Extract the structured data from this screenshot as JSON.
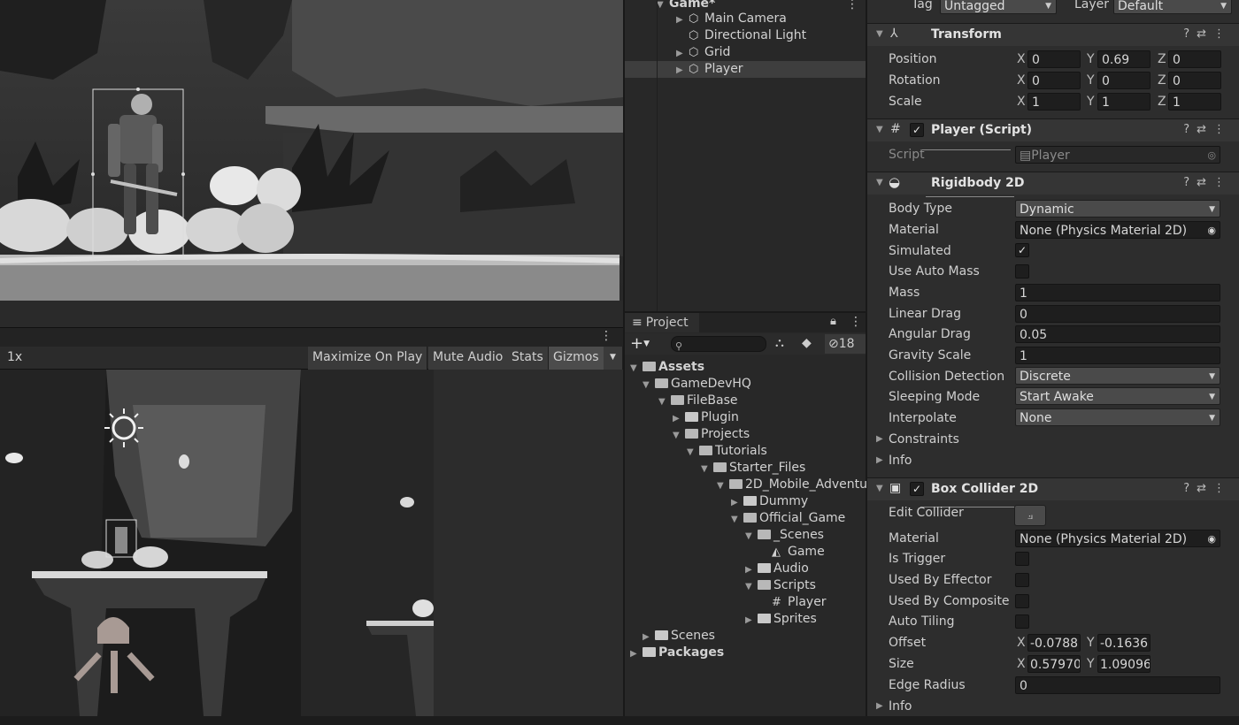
{
  "hierarchy": {
    "root": "Game*",
    "items": [
      {
        "label": "Main Camera",
        "selected": false
      },
      {
        "label": "Directional Light",
        "selected": false
      },
      {
        "label": "Grid",
        "selected": false
      },
      {
        "label": "Player",
        "selected": true
      }
    ]
  },
  "scene_toolbar": {
    "menu_icon": "kebab-icon"
  },
  "game_toolbar": {
    "scale": "1x",
    "maximize": "Maximize On Play",
    "mute": "Mute Audio",
    "stats": "Stats",
    "gizmos": "Gizmos"
  },
  "project": {
    "tab": "Project",
    "add_label": "+",
    "hidden_count": "18",
    "tree": [
      {
        "label": "Assets",
        "kind": "folder",
        "bold": true
      },
      {
        "label": "GameDevHQ",
        "kind": "folder"
      },
      {
        "label": "FileBase",
        "kind": "folder"
      },
      {
        "label": "Plugin",
        "kind": "folder"
      },
      {
        "label": "Projects",
        "kind": "folder"
      },
      {
        "label": "Tutorials",
        "kind": "folder"
      },
      {
        "label": "Starter_Files",
        "kind": "folder"
      },
      {
        "label": "2D_Mobile_Adventu",
        "kind": "folder"
      },
      {
        "label": "Dummy",
        "kind": "folder"
      },
      {
        "label": "Official_Game",
        "kind": "folder"
      },
      {
        "label": "_Scenes",
        "kind": "folder"
      },
      {
        "label": "Game",
        "kind": "scene"
      },
      {
        "label": "Audio",
        "kind": "folder"
      },
      {
        "label": "Scripts",
        "kind": "folder"
      },
      {
        "label": "Player",
        "kind": "script"
      },
      {
        "label": "Sprites",
        "kind": "folder"
      },
      {
        "label": "Scenes",
        "kind": "folder"
      },
      {
        "label": "Packages",
        "kind": "folder",
        "bold": true
      }
    ]
  },
  "inspector": {
    "tag_label": "Tag",
    "tag_value": "Untagged",
    "layer_label": "Layer",
    "layer_value": "Default",
    "transform": {
      "title": "Transform",
      "position_label": "Position",
      "position": {
        "x": "0",
        "y": "0.69",
        "z": "0"
      },
      "rotation_label": "Rotation",
      "rotation": {
        "x": "0",
        "y": "0",
        "z": "0"
      },
      "scale_label": "Scale",
      "scale": {
        "x": "1",
        "y": "1",
        "z": "1"
      }
    },
    "player_script": {
      "title": "Player (Script)",
      "script_label": "Script",
      "script_value": "Player"
    },
    "rigidbody": {
      "title": "Rigidbody 2D",
      "body_type_label": "Body Type",
      "body_type": "Dynamic",
      "material_label": "Material",
      "material": "None (Physics Material 2D)",
      "simulated_label": "Simulated",
      "use_auto_mass_label": "Use Auto Mass",
      "mass_label": "Mass",
      "mass": "1",
      "linear_drag_label": "Linear Drag",
      "linear_drag": "0",
      "angular_drag_label": "Angular Drag",
      "angular_drag": "0.05",
      "gravity_scale_label": "Gravity Scale",
      "gravity_scale": "1",
      "collision_label": "Collision Detection",
      "collision": "Discrete",
      "sleeping_label": "Sleeping Mode",
      "sleeping": "Start Awake",
      "interpolate_label": "Interpolate",
      "interpolate": "None",
      "constraints_label": "Constraints",
      "info_label": "Info"
    },
    "box_collider": {
      "title": "Box Collider 2D",
      "edit_collider_label": "Edit Collider",
      "material_label": "Material",
      "material": "None (Physics Material 2D)",
      "is_trigger_label": "Is Trigger",
      "used_by_effector_label": "Used By Effector",
      "used_by_composite_label": "Used By Composite",
      "auto_tiling_label": "Auto Tiling",
      "offset_label": "Offset",
      "offset": {
        "x": "-0.0788",
        "y": "-0.1636"
      },
      "size_label": "Size",
      "size": {
        "x": "0.57970",
        "y": "1.09096"
      },
      "edge_radius_label": "Edge Radius",
      "edge_radius": "0",
      "info_label": "Info"
    },
    "axis": {
      "x": "X",
      "y": "Y",
      "z": "Z"
    }
  }
}
